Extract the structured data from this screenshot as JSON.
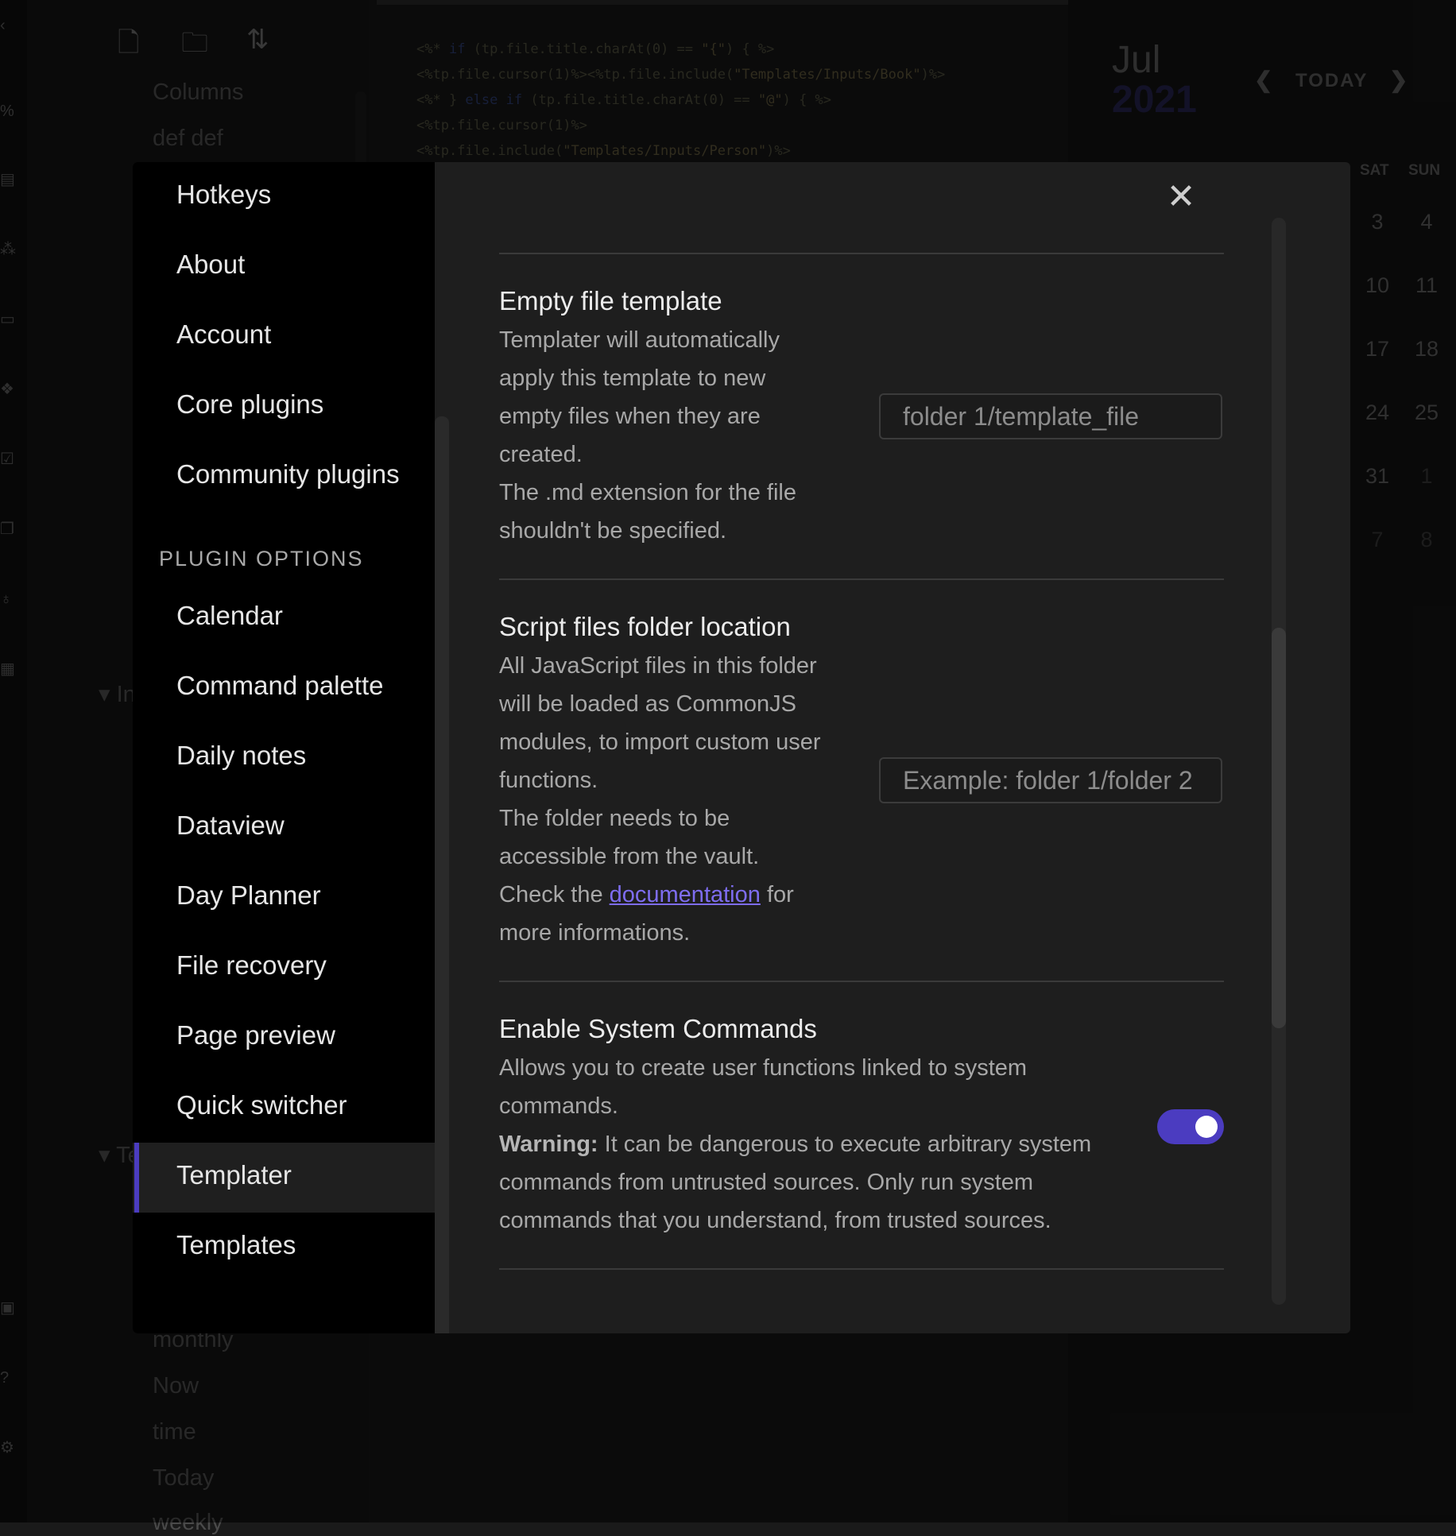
{
  "background": {
    "file_items_top": [
      "Columns",
      "def def"
    ],
    "file_items_bottom": [
      "monthly",
      "Now",
      "time",
      "Today",
      "weekly"
    ],
    "folders": [
      "Inp",
      "Te"
    ],
    "code_lines": [
      {
        "a": "<%* ",
        "k": "if",
        "b": " (tp.file.title.charAt(0) == ",
        "s": "\"{\"",
        "c": ") { %>"
      },
      {
        "a": "<%tp.file.cursor(1)%><%tp.file.include(",
        "k": "",
        "b": "",
        "s": "\"Templates/Inputs/Book\"",
        "c": ")%>"
      },
      {
        "a": "<%* } ",
        "k": "else if",
        "b": " (tp.file.title.charAt(0) == ",
        "s": "\"@\"",
        "c": ") { %>"
      },
      {
        "a": "<%tp.file.cursor(1)%>",
        "k": "",
        "b": "",
        "s": "",
        "c": ""
      },
      {
        "a": "<%tp.file.include(",
        "k": "",
        "b": "",
        "s": "\"Templates/Inputs/Person\"",
        "c": ")%>"
      }
    ],
    "calendar": {
      "month": "Jul",
      "year": "2021",
      "today_label": "TODAY",
      "dow": [
        "SAT",
        "SUN"
      ],
      "rows": [
        [
          "3",
          "4"
        ],
        [
          "10",
          "11"
        ],
        [
          "17",
          "18"
        ],
        [
          "24",
          "25"
        ],
        [
          "31",
          "1"
        ],
        [
          "7",
          "8"
        ]
      ]
    }
  },
  "settings": {
    "nav_top": [
      "Hotkeys",
      "About",
      "Account",
      "Core plugins",
      "Community plugins"
    ],
    "plugin_options_heading": "PLUGIN OPTIONS",
    "nav_plugins": [
      "Calendar",
      "Command palette",
      "Daily notes",
      "Dataview",
      "Day Planner",
      "File recovery",
      "Page preview",
      "Quick switcher",
      "Templater",
      "Templates"
    ],
    "active_item": "Templater",
    "close_symbol": "✕",
    "empty_file_template": {
      "title": "Empty file template",
      "desc_lines": [
        "Templater will automatically",
        "apply this template to new",
        "empty files when they are",
        "created.",
        "The .md extension for the file",
        "shouldn't be specified."
      ],
      "placeholder": "folder 1/template_file"
    },
    "script_folder": {
      "title": "Script files folder location",
      "desc_lines": [
        "All JavaScript files in this folder",
        "will be loaded as CommonJS",
        "modules, to import custom user",
        "functions.",
        "The folder needs to be",
        "accessible from the vault."
      ],
      "check_prefix": "Check the ",
      "link_text": "documentation",
      "check_suffix": " for",
      "last_line": "more informations.",
      "placeholder": "Example: folder 1/folder 2"
    },
    "system_commands": {
      "title": "Enable System Commands",
      "desc_lines": [
        "Allows you to create user functions linked to system",
        "commands."
      ],
      "warning_label": "Warning:",
      "warning_text": " It can be dangerous to execute arbitrary system",
      "warning_lines": [
        "commands from untrusted sources. Only run system",
        "commands that you understand, from trusted sources."
      ],
      "enabled": true,
      "accent_color": "#4b3cc0"
    }
  }
}
